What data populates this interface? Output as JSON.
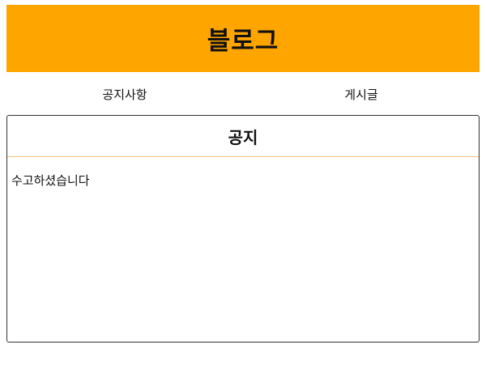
{
  "header": {
    "title": "블로그"
  },
  "nav": {
    "items": [
      {
        "label": "공지사항"
      },
      {
        "label": "게시글"
      }
    ]
  },
  "notice": {
    "title": "공지",
    "content": "수고하셨습니다"
  },
  "colors": {
    "header_background": "#ffa500",
    "divider": "#f0c080",
    "border": "#333333"
  }
}
